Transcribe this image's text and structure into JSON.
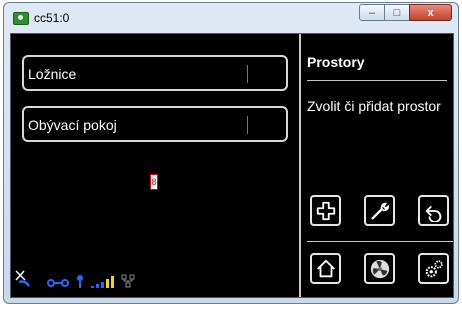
{
  "window": {
    "title": "cc51:0",
    "controls": {
      "minimize": "–",
      "maximize": "□",
      "close": "x"
    }
  },
  "rooms": [
    {
      "label": "Ložnice"
    },
    {
      "label": "Obývací pokoj"
    }
  ],
  "marker": {
    "text": "8"
  },
  "panel": {
    "title": "Prostory",
    "text": "Zvolit či přidat prostor"
  },
  "toolbar": {
    "row1": [
      "plus-icon",
      "wrench-icon",
      "undo-icon"
    ],
    "row2": [
      "home-icon",
      "fan-icon",
      "gears-icon"
    ]
  },
  "status_icons": [
    "tools-icon",
    "link-icon",
    "antenna-icon",
    "signal-icon",
    "network-icon"
  ],
  "colors": {
    "background": "#000000",
    "text": "#ffffff",
    "border": "#d8d8d8",
    "status": "#1e6cff",
    "signal": "#ffd400"
  }
}
